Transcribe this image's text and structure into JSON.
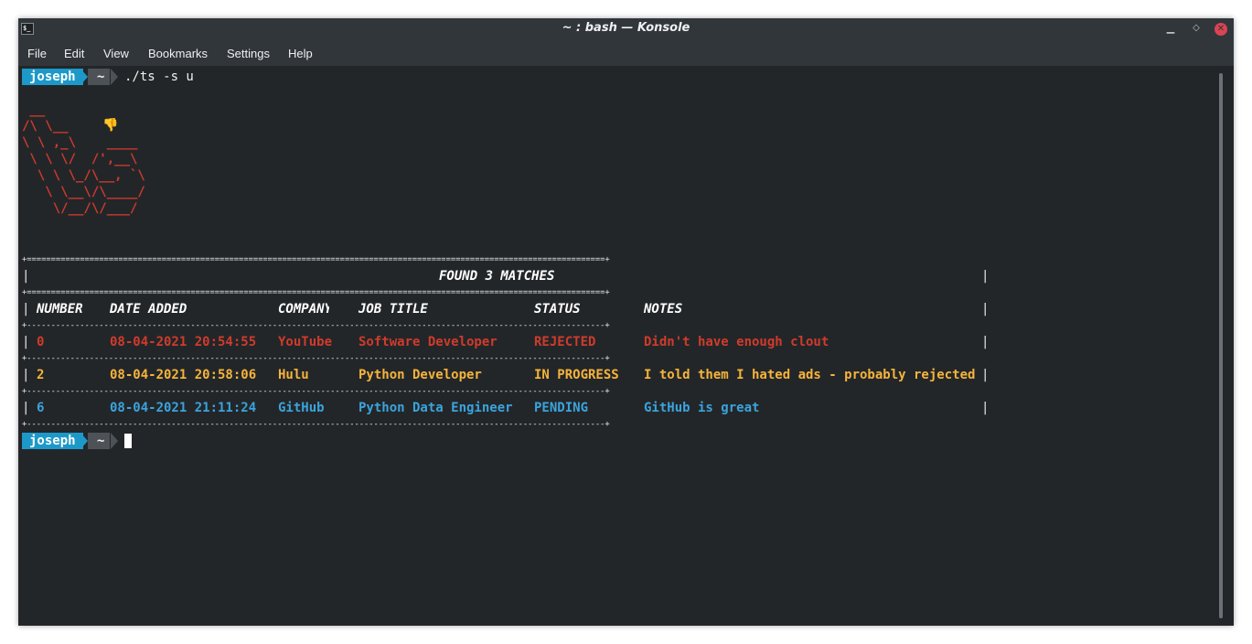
{
  "window": {
    "title": "~ : bash — Konsole",
    "app_icon": "$_",
    "controls": {
      "minimize_icon": "minimize-icon",
      "maximize_icon": "maximize-icon",
      "close_icon": "close-icon"
    }
  },
  "menu": [
    "File",
    "Edit",
    "View",
    "Bookmarks",
    "Settings",
    "Help"
  ],
  "prompt": {
    "user": "joseph",
    "dir": "~",
    "command": "./ts -s u"
  },
  "art": [
    " __",
    "/\\ \\__     ",
    "\\ \\ ,_\\    ____",
    " \\ \\ \\/  /',__\\",
    "  \\ \\ \\_/\\__, `\\",
    "   \\ \\__\\/\\____/",
    "    \\/__/\\/___/"
  ],
  "table": {
    "border_eq": "+========================================================================================================================+",
    "border_dash": "+------------------------------------------------------------------------------------------------------------------------+",
    "title": "FOUND 3 MATCHES",
    "headers": [
      "NUMBER",
      "DATE ADDED",
      "COMPANY",
      "JOB TITLE",
      "STATUS",
      "NOTES"
    ],
    "rows": [
      {
        "number": "0",
        "date": "08-04-2021 20:54:55",
        "company": "YouTube",
        "title": "Software Developer",
        "status": "REJECTED",
        "notes": "Didn't have enough clout",
        "color": "#d03b2b"
      },
      {
        "number": "2",
        "date": "08-04-2021 20:58:06",
        "company": "Hulu",
        "title": "Python Developer",
        "status": "IN PROGRESS",
        "notes": "I told them I hated ads - probably rejected",
        "color": "#f6b43a"
      },
      {
        "number": "6",
        "date": "08-04-2021 21:11:24",
        "company": "GitHub",
        "title": "Python Data Engineer",
        "status": "PENDING",
        "notes": "GitHub is great",
        "color": "#3aa4dd"
      }
    ]
  },
  "prompt2": {
    "user": "joseph",
    "dir": "~"
  },
  "colors": {
    "background": "#232629",
    "prompt_user_bg": "#1d99c9",
    "prompt_dir_bg": "#4d5257"
  }
}
